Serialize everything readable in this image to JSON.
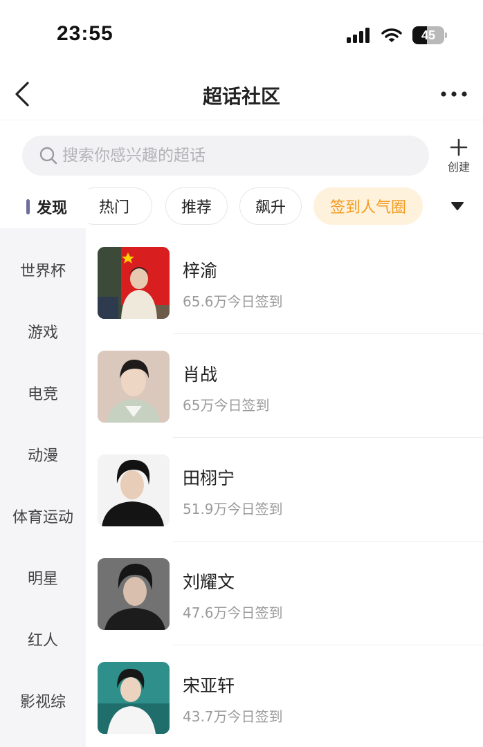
{
  "status_bar": {
    "time": "23:55",
    "battery_level": "45",
    "battery_fraction": 0.45,
    "icons": [
      "signal-icon",
      "wifi-icon",
      "battery-icon"
    ]
  },
  "nav": {
    "title": "超话社区",
    "back_icon": "chevron-left-icon",
    "more_icon": "more-horizontal-icon"
  },
  "search": {
    "placeholder": "搜索你感兴趣的超话",
    "value": "",
    "create_label": "创建"
  },
  "tabs": {
    "discover_label": "发现",
    "chips": [
      {
        "label": "热门",
        "active": false
      },
      {
        "label": "推荐",
        "active": false
      },
      {
        "label": "飙升",
        "active": false
      },
      {
        "label": "签到人气圈",
        "active": true
      }
    ],
    "active_color": "#f29a1f"
  },
  "sidebar": {
    "items": [
      {
        "label": "世界杯"
      },
      {
        "label": "游戏"
      },
      {
        "label": "电竞"
      },
      {
        "label": "动漫"
      },
      {
        "label": "体育运动"
      },
      {
        "label": "明星"
      },
      {
        "label": "红人"
      },
      {
        "label": "影视综"
      }
    ]
  },
  "topics": [
    {
      "name": "梓渝",
      "count": "65.6万今日签到"
    },
    {
      "name": "肖战",
      "count": "65万今日签到"
    },
    {
      "name": "田栩宁",
      "count": "51.9万今日签到"
    },
    {
      "name": "刘耀文",
      "count": "47.6万今日签到"
    },
    {
      "name": "宋亚轩",
      "count": "43.7万今日签到"
    }
  ]
}
